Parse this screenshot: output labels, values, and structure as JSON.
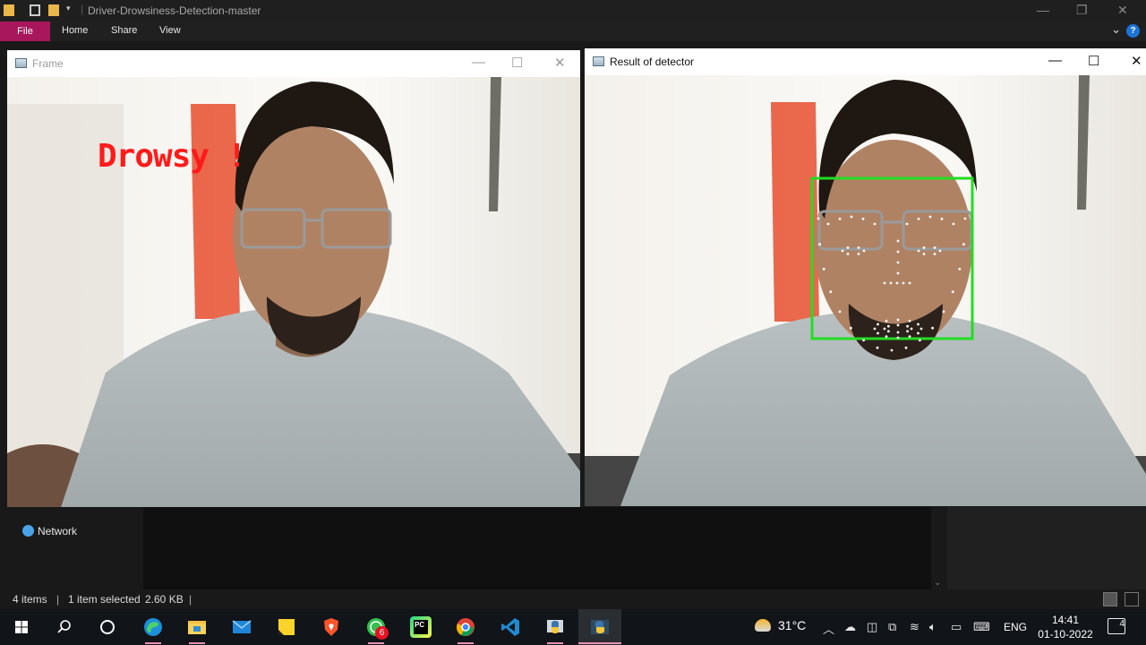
{
  "explorer": {
    "title": "Driver-Drowsiness-Detection-master",
    "ribbon_tabs": [
      "File",
      "Home",
      "Share",
      "View"
    ],
    "nav_network": "Network",
    "status": {
      "items": "4 items",
      "selected": "1 item selected",
      "size": "2.60 KB"
    }
  },
  "frame_window": {
    "title": "Frame",
    "alert_text": "Drowsy !",
    "alert_color": "#ff1a1a"
  },
  "detector_window": {
    "title": "Result of detector",
    "box_color": "#22dd22"
  },
  "taskbar": {
    "apps": [
      "start-icon",
      "search-icon",
      "task-view-icon",
      "edge-icon",
      "file-explorer-icon",
      "mail-icon",
      "sticky-notes-icon",
      "brave-icon",
      "whatsapp-icon",
      "pycharm-icon",
      "chrome-icon",
      "vscode-icon",
      "python-idle-icon",
      "python-icon"
    ],
    "whatsapp_badge": "6",
    "pycharm_label": "PC",
    "weather_temp": "31°C",
    "language": "ENG",
    "time": "14:41",
    "date": "01-10-2022",
    "notification_count": "4",
    "accent": "#e88fb6"
  }
}
